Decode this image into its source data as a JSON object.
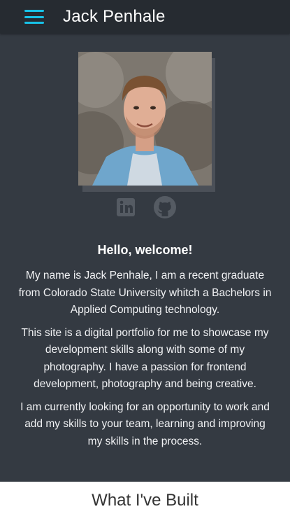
{
  "header": {
    "title": "Jack Penhale",
    "menu_icon": "hamburger-menu-icon",
    "accent_color": "#17c3e8"
  },
  "profile": {
    "photo_alt": "Jack Penhale",
    "social_links": [
      {
        "name": "linkedin",
        "icon": "linkedin-icon"
      },
      {
        "name": "github",
        "icon": "github-icon"
      }
    ]
  },
  "intro": {
    "greeting": "Hello, welcome!",
    "paragraphs": [
      "My name is Jack Penhale, I am a recent graduate from Colorado State University whitch a Bachelors in Applied Computing technology.",
      "This site is a digital portfolio for me to showcase my development skills along with some of my photography. I have a passion for frontend development, photography and being creative.",
      "I am currently looking for an opportunity to work and add my skills to your team, learning and improving my skills in the process."
    ]
  },
  "built": {
    "title": "What I've Built"
  }
}
